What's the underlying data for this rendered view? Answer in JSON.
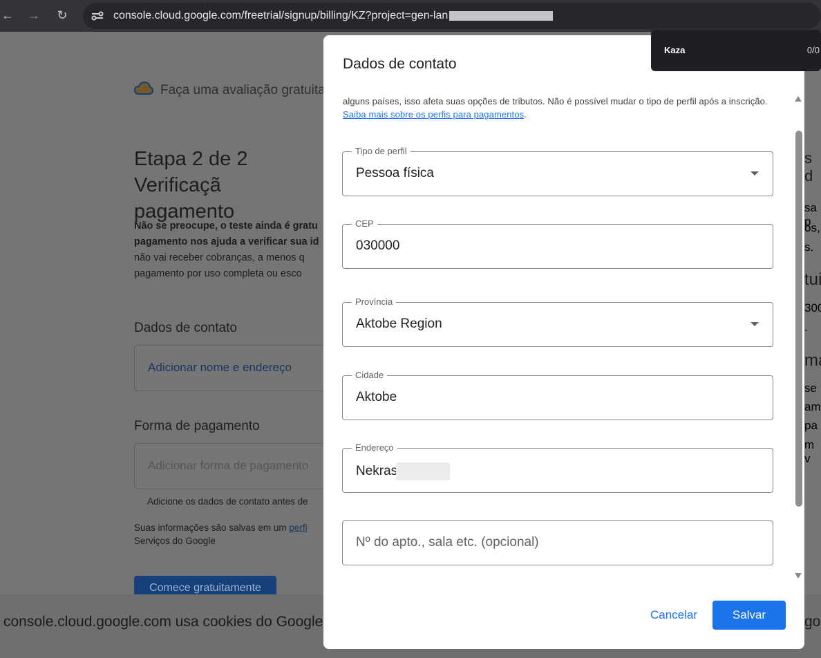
{
  "browser": {
    "url": "console.cloud.google.com/freetrial/signup/billing/KZ?project=gen-lan"
  },
  "underlying_page": {
    "trial_title": "Faça uma avaliação gratuita c",
    "step_title_line1": "Etapa 2 de 2 Verificaçã",
    "step_title_line2": "pagamento",
    "desc_line1": "Não se preocupe, o teste ainda é gratu",
    "desc_line2": "pagamento nos ajuda a verificar sua id",
    "desc_line3": "não vai receber cobranças, a menos q",
    "desc_line4": "pagamento por uso completa ou esco",
    "contact_heading": "Dados de contato",
    "contact_link": "Adicionar nome e endereço",
    "payment_heading": "Forma de pagamento",
    "payment_placeholder": "Adicionar forma de pagamento",
    "payment_hint": "Adicione os dados de contato antes de",
    "info_line1": "Suas informações são salvas em um ",
    "info_link": "perfi",
    "info_line2": "Serviços do Google",
    "begin_button": "Comece gratuitamente",
    "cookie_text": "console.cloud.google.com usa cookies do Google",
    "cookie_tail": "go",
    "right_peek": [
      "s d",
      "sa p",
      "os,",
      "s.",
      "tui",
      "300",
      ".",
      "ma",
      "se",
      "ame",
      "pa",
      "m v"
    ]
  },
  "toast": {
    "name": "Kaza",
    "count": "0/0"
  },
  "dialog": {
    "title": "Dados de contato",
    "help_text": "alguns países, isso afeta suas opções de tributos. Não é possível mudar o tipo de perfil após a inscrição. ",
    "help_link": "Saiba mais sobre os perfis para pagamentos",
    "help_end": ".",
    "fields": [
      {
        "label": "Tipo de perfil",
        "value": "Pessoa física"
      },
      {
        "label": "CEP",
        "value": "030000"
      },
      {
        "label": "Província",
        "value": "Aktobe Region"
      },
      {
        "label": "Cidade",
        "value": "Aktobe"
      },
      {
        "label": "Endereço",
        "value": "Nekras"
      },
      {
        "label": "",
        "placeholder": "Nº do apto., sala etc. (opcional)"
      }
    ],
    "cancel_label": "Cancelar",
    "save_label": "Salvar"
  }
}
